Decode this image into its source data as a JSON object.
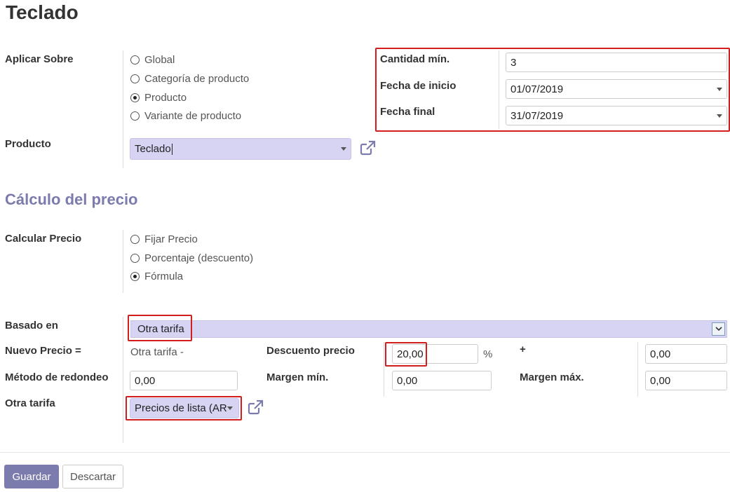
{
  "page": {
    "title": "Teclado"
  },
  "apply": {
    "label": "Aplicar Sobre",
    "options": [
      "Global",
      "Categoría de producto",
      "Producto",
      "Variante de producto"
    ],
    "selected": "Producto"
  },
  "product": {
    "label": "Producto",
    "value": "Teclado"
  },
  "conditions": {
    "min_qty_label": "Cantidad mín.",
    "min_qty_value": "3",
    "start_label": "Fecha de inicio",
    "start_value": "01/07/2019",
    "end_label": "Fecha final",
    "end_value": "31/07/2019"
  },
  "section": {
    "title": "Cálculo del precio"
  },
  "compute": {
    "label": "Calcular Precio",
    "options": [
      "Fijar Precio",
      "Porcentaje (descuento)",
      "Fórmula"
    ],
    "selected": "Fórmula"
  },
  "based_on": {
    "label": "Basado en",
    "value": "Otra tarifa"
  },
  "formula": {
    "new_price_label": "Nuevo Precio =",
    "new_price_text": "Otra tarifa -",
    "discount_label": "Descuento precio",
    "discount_value": "20,00",
    "percent_sign": "%",
    "plus_sign": "+",
    "surcharge_value": "0,00",
    "rounding_label": "Método de redondeo",
    "rounding_value": "0,00",
    "min_margin_label": "Margen mín.",
    "min_margin_value": "0,00",
    "max_margin_label": "Margen máx.",
    "max_margin_value": "0,00"
  },
  "other_pricelist": {
    "label": "Otra tarifa",
    "value": "Precios de lista (AR"
  },
  "buttons": {
    "save": "Guardar",
    "discard": "Descartar"
  },
  "colors": {
    "accent": "#7c7bad",
    "highlight": "#d11f1f",
    "selected_field": "#d6d3f3"
  }
}
